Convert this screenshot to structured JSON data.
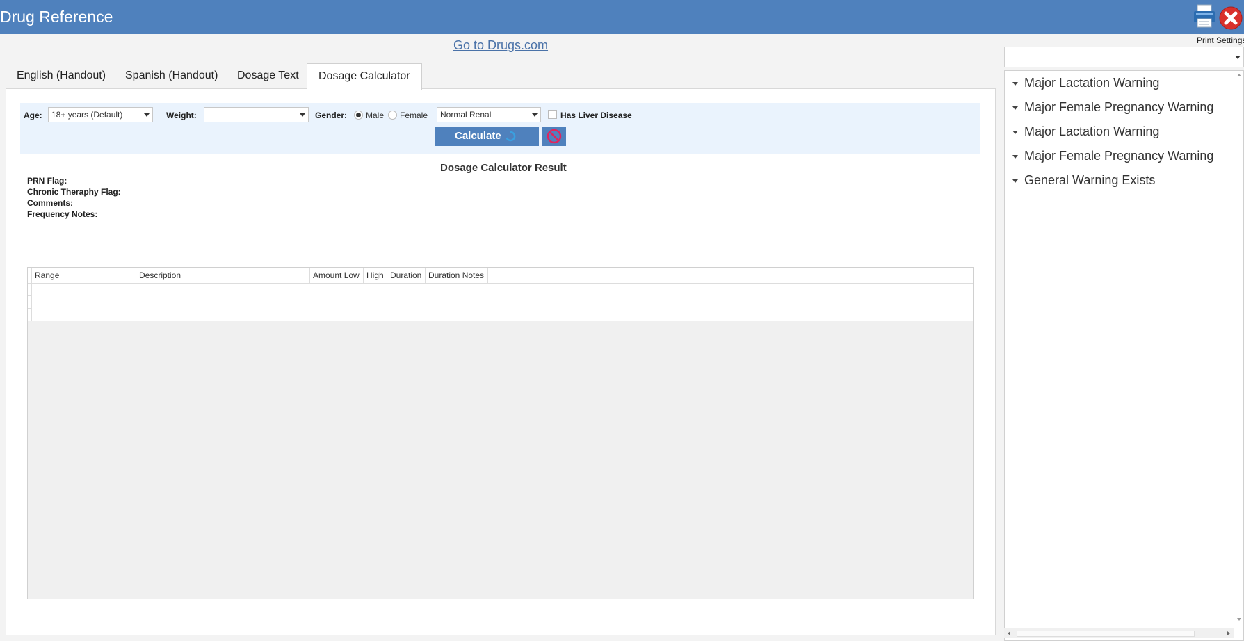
{
  "window": {
    "title": "Drug Reference"
  },
  "toolbar": {
    "print_settings_label": "Print Settings"
  },
  "link": {
    "drugs_com": "Go to Drugs.com"
  },
  "tabs": [
    {
      "label": "English (Handout)"
    },
    {
      "label": "Spanish (Handout)"
    },
    {
      "label": "Dosage Text"
    },
    {
      "label": "Dosage Calculator"
    }
  ],
  "active_tab": "Dosage Calculator",
  "calculator": {
    "age_label": "Age:",
    "age_value": "18+ years (Default)",
    "weight_label": "Weight:",
    "weight_value": "",
    "gender_label": "Gender:",
    "gender_options": [
      "Male",
      "Female"
    ],
    "gender_selected": "Male",
    "renal_value": "Normal Renal",
    "liver_label": "Has Liver Disease",
    "liver_checked": false,
    "calculate_label": "Calculate"
  },
  "result": {
    "title": "Dosage Calculator Result",
    "flags": [
      "PRN Flag:",
      "Chronic Theraphy Flag:",
      "Comments:",
      "Frequency Notes:"
    ]
  },
  "table": {
    "columns": [
      "Range",
      "Description",
      "Amount Low",
      "High",
      "Duration",
      "Duration Notes"
    ],
    "rows": []
  },
  "sidebar": {
    "selector_value": "",
    "warnings": [
      "Major Lactation Warning",
      "Major Female Pregnancy Warning",
      "Major Lactation Warning",
      "Major Female Pregnancy Warning",
      "General Warning Exists"
    ]
  },
  "colors": {
    "titlebar": "#4f81bd",
    "accent": "#4f81bd",
    "panel_bg": "#eaf3fd"
  },
  "icons": [
    "printer-icon",
    "close-icon",
    "refresh-spinner-icon",
    "prohibited-icon"
  ]
}
